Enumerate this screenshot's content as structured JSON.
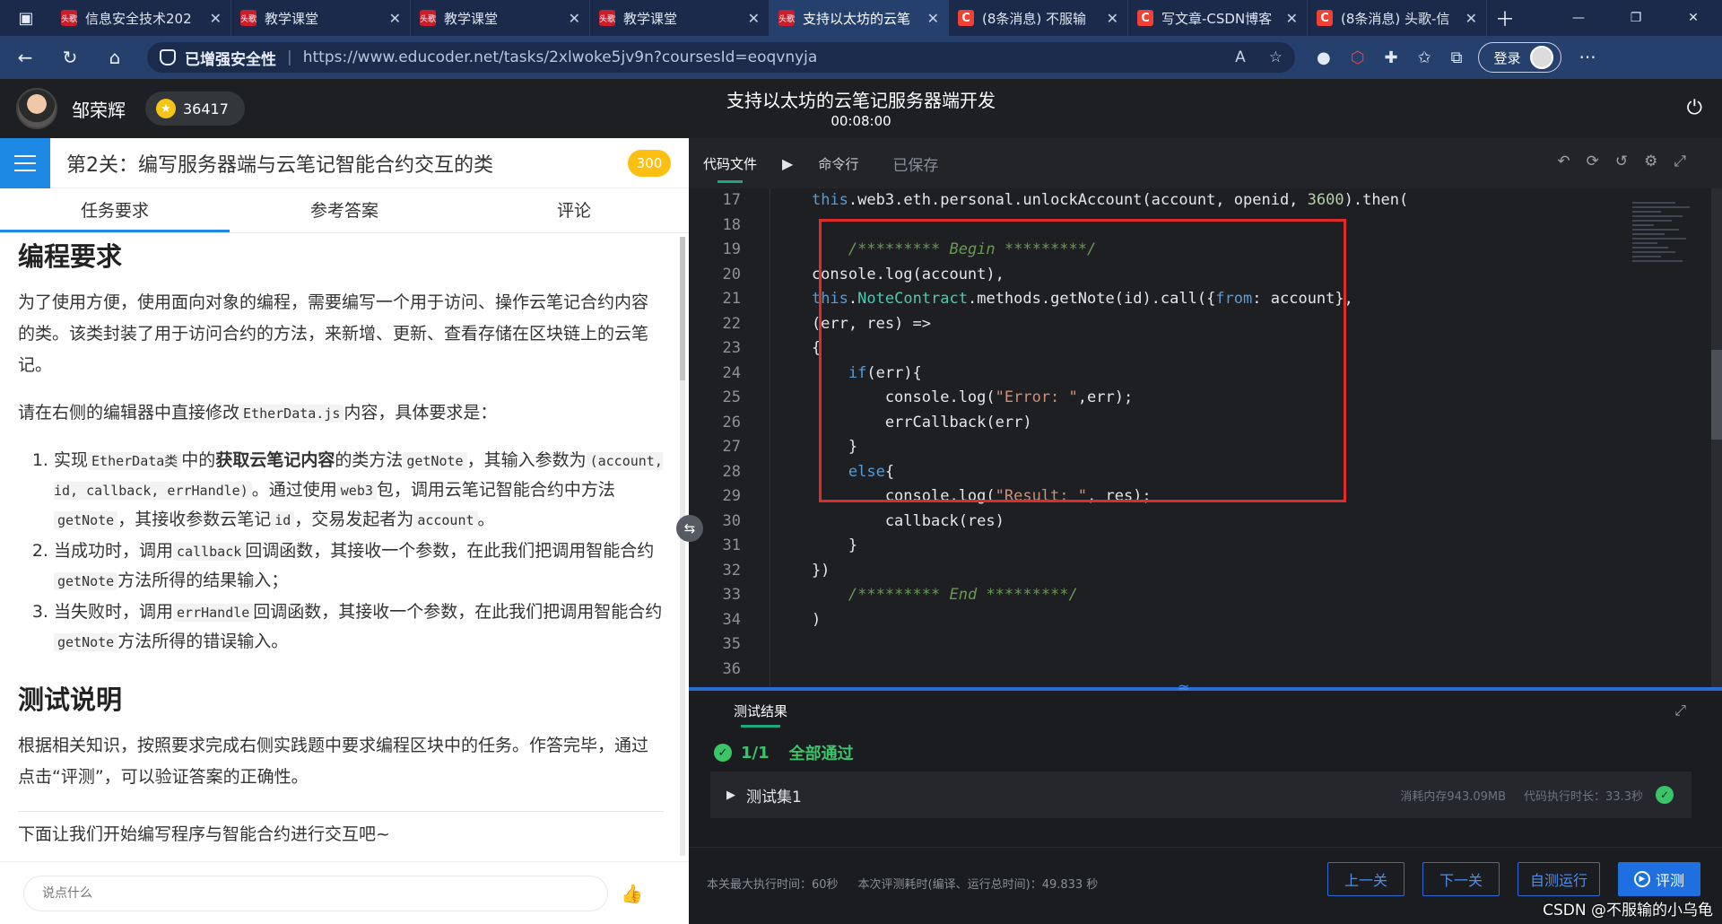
{
  "browser": {
    "tabs": [
      {
        "label": "信息安全技术202",
        "favicon": "edu"
      },
      {
        "label": "教学课堂",
        "favicon": "edu"
      },
      {
        "label": "教学课堂",
        "favicon": "edu"
      },
      {
        "label": "教学课堂",
        "favicon": "edu"
      },
      {
        "label": "支持以太坊的云笔",
        "favicon": "edu",
        "active": true
      },
      {
        "label": "(8条消息) 不服输",
        "favicon": "csdn"
      },
      {
        "label": "写文章-CSDN博客",
        "favicon": "csdn"
      },
      {
        "label": "(8条消息) 头歌-信",
        "favicon": "csdn"
      }
    ],
    "security_label": "已增强安全性",
    "url": "https://www.educoder.net/tasks/2xlwoke5jv9n?coursesId=eoqvnyja",
    "login_label": "登录"
  },
  "header": {
    "user_name": "邹荣辉",
    "coins": "36417",
    "title": "支持以太坊的云笔记服务器端开发",
    "timer": "00:08:00"
  },
  "left": {
    "stage_title": "第2关：编写服务器端与云笔记智能合约交互的类",
    "score": "300",
    "tabs": [
      "任务要求",
      "参考答案",
      "评论"
    ],
    "h_programming": "编程要求",
    "p1": "为了使用方便，使用面向对象的编程，需要编写一个用于访问、操作云笔记合约内容的类。该类封装了用于访问合约的方法，来新增、更新、查看存储在区块链上的云笔记。",
    "p2_a": "请在右侧的编辑器中直接修改",
    "p2_code": "EtherData.js",
    "p2_b": "内容，具体要求是：",
    "li1_a": "实现",
    "li1_code1": "EtherData类",
    "li1_b": "中的",
    "li1_bold": "获取云笔记内容",
    "li1_c": "的类方法",
    "li1_code2": "getNote",
    "li1_d": "，其输入参数为",
    "li1_code3": "(account, id, callback, errHandle)",
    "li1_e": "。通过使用",
    "li1_code4": "web3",
    "li1_f": "包，调用云笔记智能合约中方法",
    "li1_code5": "getNote",
    "li1_g": "，其接收参数云笔记",
    "li1_code6": "id",
    "li1_h": "，交易发起者为",
    "li1_code7": "account",
    "li1_i": "。",
    "li2_a": "当成功时，调用",
    "li2_code": "callback",
    "li2_b": "回调函数，其接收一个参数，在此我们把调用智能合约",
    "li2_code2": "getNote",
    "li2_c": "方法所得的结果输入；",
    "li3_a": "当失败时，调用",
    "li3_code": "errHandle",
    "li3_b": "回调函数，其接收一个参数，在此我们把调用智能合约",
    "li3_code2": "getNote",
    "li3_c": "方法所得的错误输入。",
    "h_test": "测试说明",
    "p3": "根据相关知识，按照要求完成右侧实践题中要求编程区块中的任务。作答完毕，通过点击“评测”，可以验证答案的正确性。",
    "p4": "下面让我们开始编写程序与智能合约进行交互吧~",
    "comment_placeholder": "说点什么"
  },
  "right": {
    "tabs": [
      "代码文件",
      "命令行"
    ],
    "saved": "已保存",
    "line_numbers": [
      "17",
      "18",
      "19",
      "20",
      "21",
      "22",
      "23",
      "24",
      "25",
      "26",
      "27",
      "28",
      "29",
      "30",
      "31",
      "32",
      "33",
      "34",
      "35",
      "36"
    ],
    "results_tab": "测试结果",
    "pass_count": "1/1",
    "pass_label": "全部通过",
    "testset_label": "测试集1",
    "testset_mem": "消耗内存943.09MB",
    "testset_time": "代码执行时长：33.3秒",
    "max_time": "本关最大执行时间：60秒",
    "eval_time": "本次评测耗时(编译、运行总时间)：49.833 秒",
    "btn_prev": "上一关",
    "btn_next": "下一关",
    "btn_self": "自测运行",
    "btn_eval": "评测"
  },
  "watermark": "CSDN @不服输的小乌龟"
}
